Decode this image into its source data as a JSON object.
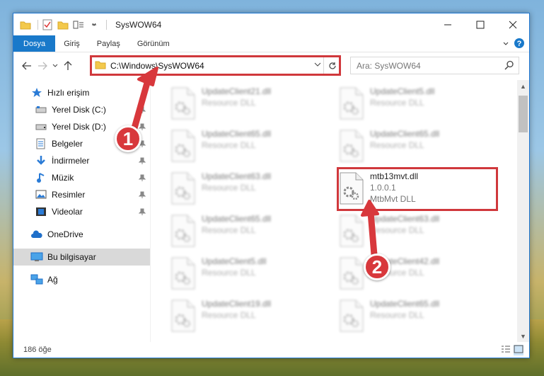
{
  "window": {
    "title": "SysWOW64"
  },
  "ribbon": {
    "tabs": [
      "Dosya",
      "Giriş",
      "Paylaş",
      "Görünüm"
    ]
  },
  "address": {
    "path": "C:\\Windows\\SysWOW64"
  },
  "search": {
    "placeholder": "Ara: SysWOW64"
  },
  "sidebar": {
    "items": [
      {
        "label": "Hızlı erişim",
        "icon": "star-icon"
      },
      {
        "label": "Yerel Disk (C:)",
        "icon": "drive-icon"
      },
      {
        "label": "Yerel Disk (D:)",
        "icon": "drive-icon"
      },
      {
        "label": "Belgeler",
        "icon": "documents-icon"
      },
      {
        "label": "İndirmeler",
        "icon": "download-icon"
      },
      {
        "label": "Müzik",
        "icon": "music-icon"
      },
      {
        "label": "Resimler",
        "icon": "pictures-icon"
      },
      {
        "label": "Videolar",
        "icon": "video-icon"
      },
      {
        "label": "OneDrive",
        "icon": "cloud-icon"
      },
      {
        "label": "Bu bilgisayar",
        "icon": "computer-icon"
      },
      {
        "label": "Ağ",
        "icon": "network-icon"
      }
    ]
  },
  "files": [
    {
      "name": "UpdateClient21.dll",
      "sub1": "Resource DLL",
      "sub2": ""
    },
    {
      "name": "UpdateClient5.dll",
      "sub1": "Resource DLL",
      "sub2": ""
    },
    {
      "name": "UpdateClient65.dll",
      "sub1": "Resource DLL",
      "sub2": ""
    },
    {
      "name": "UpdateClient65.dll",
      "sub1": "Resource DLL",
      "sub2": ""
    },
    {
      "name": "UpdateClient63.dll",
      "sub1": "Resource DLL",
      "sub2": ""
    },
    {
      "name": "mtb13mvt.dll",
      "sub1": "1.0.0.1",
      "sub2": "MtbMvt DLL"
    },
    {
      "name": "UpdateClient65.dll",
      "sub1": "Resource DLL",
      "sub2": ""
    },
    {
      "name": "UpdateClient63.dll",
      "sub1": "Resource DLL",
      "sub2": ""
    },
    {
      "name": "UpdateClient5.dll",
      "sub1": "Resource DLL",
      "sub2": ""
    },
    {
      "name": "UpdateClient42.dll",
      "sub1": "Resource DLL",
      "sub2": ""
    },
    {
      "name": "UpdateClient19.dll",
      "sub1": "Resource DLL",
      "sub2": ""
    },
    {
      "name": "UpdateClient65.dll",
      "sub1": "Resource DLL",
      "sub2": ""
    }
  ],
  "status": {
    "count": "186 öğe"
  },
  "callouts": [
    "1",
    "2"
  ],
  "colors": {
    "accent": "#1979ca",
    "highlight_red": "#d0383c"
  }
}
